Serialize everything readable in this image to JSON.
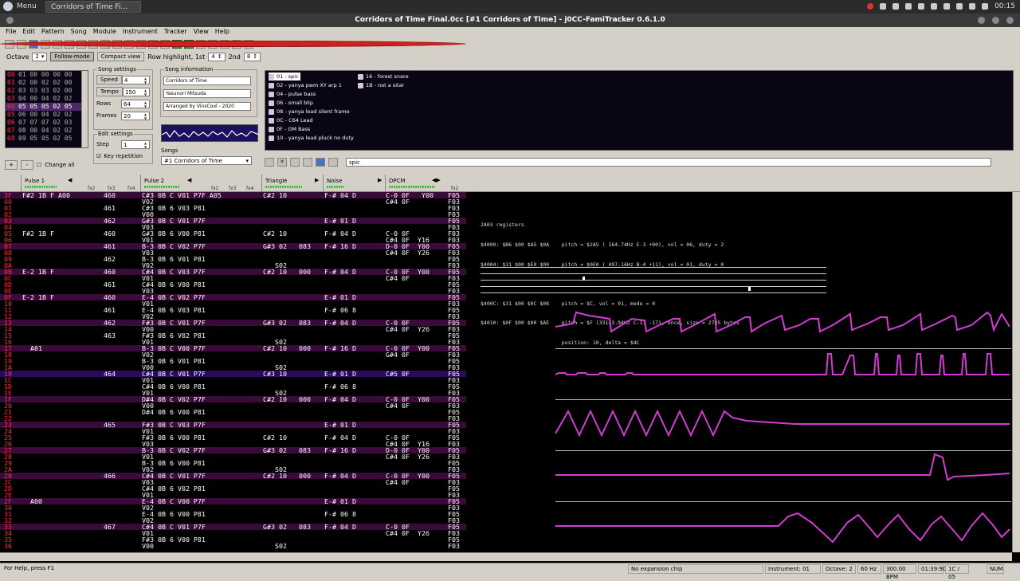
{
  "taskbar": {
    "menu_label": "Menu",
    "task_label": "Corridors of Time Fi...",
    "clock": "00:15"
  },
  "window": {
    "title": "Corridors of Time Final.0cc [#1 Corridors of Time] - j0CC-FamiTracker 0.6.1.0"
  },
  "menubar": [
    "File",
    "Edit",
    "Pattern",
    "Song",
    "Module",
    "Instrument",
    "Tracker",
    "View",
    "Help"
  ],
  "options": {
    "octave_label": "Octave",
    "octave_value": "2",
    "follow": "Follow-mode",
    "compact": "Compact view",
    "highlight_label": "Row highlight, 1st",
    "highlight1": "4",
    "second_label": "2nd",
    "highlight2": "8"
  },
  "frames": [
    {
      "n": "00",
      "v": "01 00 00 00 00"
    },
    {
      "n": "01",
      "v": "02 00 02 02 00"
    },
    {
      "n": "02",
      "v": "03 03 03 02 00"
    },
    {
      "n": "03",
      "v": "04 00 04 02 02"
    },
    {
      "n": "04",
      "v": "05 05 05 02 05"
    },
    {
      "n": "05",
      "v": "06 00 04 02 02"
    },
    {
      "n": "06",
      "v": "07 07 07 02 03"
    },
    {
      "n": "07",
      "v": "08 00 04 02 02"
    },
    {
      "n": "08",
      "v": "09 05 05 02 05"
    }
  ],
  "song_settings": {
    "title": "Song settings",
    "speed_label": "Speed",
    "speed": "4",
    "tempo_label": "Tempo",
    "tempo": "150",
    "rows_label": "Rows",
    "rows": "64",
    "frames_label": "Frames",
    "frames": "20"
  },
  "edit_settings": {
    "title": "Edit settings",
    "step_label": "Step",
    "step": "1",
    "keyrep": "Key repetition"
  },
  "song_info": {
    "title": "Song information",
    "name": "Corridors of Time",
    "artist": "Yasunori Mitsuda",
    "copyright": "Arranged by VinsCool - 2020"
  },
  "songs": {
    "title": "Songs",
    "selected": "#1 Corridors of Time"
  },
  "instruments": [
    "01 - spic",
    "02 - yanya pwm XY arp 1",
    "04 - pulse bass",
    "06 - small blip",
    "08 - yanya lead silent frame",
    "0C - C64 Lead",
    "0F - GM Bass",
    "10 - yanya lead pluck no duty",
    "16 - forest snare",
    "1B - not a sitar"
  ],
  "instrument_name": "spic",
  "frame_controls": {
    "change_all": "Change all"
  },
  "channels": [
    "Pulse 1",
    "Pulse 2",
    "Triangle",
    "Noise",
    "DPCM"
  ],
  "effect_cols": [
    "fx2",
    "fx3",
    "fx4"
  ],
  "rows": [
    {
      "n": "3F",
      "p1": "F#2 1B F A00",
      "p1b": "460",
      "p2": "C#3 0B C V01 P7F A05",
      "tri": "C#2 10",
      "noi": "F-# 04 D",
      "dp": "C-0 0F   Y00",
      "end": "F05"
    },
    {
      "n": "00",
      "p1": "",
      "p1b": "",
      "p2": "V02",
      "tri": "",
      "noi": "",
      "dp": "C#4 0F",
      "end": "F03"
    },
    {
      "n": "01",
      "p1": "",
      "p1b": "461",
      "p2": "C#3 0B 6 V03 P81",
      "tri": "",
      "noi": "",
      "dp": "",
      "end": "F03"
    },
    {
      "n": "02",
      "p1": "",
      "p1b": "",
      "p2": "V00",
      "tri": "",
      "noi": "",
      "dp": "",
      "end": "F03"
    },
    {
      "n": "03",
      "p1": "",
      "p1b": "462",
      "p2": "G#3 0B C V01 P7F",
      "tri": "",
      "noi": "E-# 01 D",
      "dp": "",
      "end": "F05"
    },
    {
      "n": "04",
      "p1": "",
      "p1b": "",
      "p2": "V03",
      "tri": "",
      "noi": "",
      "dp": "",
      "end": "F03"
    },
    {
      "n": "05",
      "p1": "F#2 1B F",
      "p1b": "460",
      "p2": "G#3 0B 6 V00 P81",
      "tri": "C#2 10",
      "noi": "F-# 04 D",
      "dp": "C-0 0F",
      "end": "F03"
    },
    {
      "n": "06",
      "p1": "",
      "p1b": "",
      "p2": "V01",
      "tri": "",
      "noi": "",
      "dp": "C#4 0F  Y16",
      "end": "F03"
    },
    {
      "n": "07",
      "p1": "",
      "p1b": "461",
      "p2": "B-3 0B C V02 P7F",
      "tri": "G#3 02   083",
      "noi": "F-# 16 D",
      "dp": "D-0 0F  Y00",
      "end": "F05"
    },
    {
      "n": "08",
      "p1": "",
      "p1b": "",
      "p2": "V03",
      "tri": "",
      "noi": "",
      "dp": "C#4 0F  Y26",
      "end": "F03"
    },
    {
      "n": "09",
      "p1": "",
      "p1b": "462",
      "p2": "B-3 0B 6 V01 P81",
      "tri": "",
      "noi": "",
      "dp": "",
      "end": "F05"
    },
    {
      "n": "0A",
      "p1": "",
      "p1b": "",
      "p2": "V02",
      "tri": "   S02",
      "noi": "",
      "dp": "",
      "end": "F03"
    },
    {
      "n": "0B",
      "p1": "E-2 1B F",
      "p1b": "460",
      "p2": "C#4 0B C V03 P7F",
      "tri": "C#2 10   000",
      "noi": "F-# 04 D",
      "dp": "C-0 0F  Y00",
      "end": "F05"
    },
    {
      "n": "0C",
      "p1": "",
      "p1b": "",
      "p2": "V01",
      "tri": "",
      "noi": "",
      "dp": "C#4 0F",
      "end": "F03"
    },
    {
      "n": "0D",
      "p1": "",
      "p1b": "461",
      "p2": "C#4 0B 6 V00 P81",
      "tri": "",
      "noi": "",
      "dp": "",
      "end": "F05"
    },
    {
      "n": "0E",
      "p1": "",
      "p1b": "",
      "p2": "V03",
      "tri": "",
      "noi": "",
      "dp": "",
      "end": "F03"
    },
    {
      "n": "0F",
      "p1": "E-2 1B F",
      "p1b": "460",
      "p2": "E-4 0B C V02 P7F",
      "tri": "",
      "noi": "E-# 01 D",
      "dp": "",
      "end": "F05"
    },
    {
      "n": "10",
      "p1": "",
      "p1b": "",
      "p2": "V01",
      "tri": "",
      "noi": "",
      "dp": "",
      "end": "F03"
    },
    {
      "n": "11",
      "p1": "",
      "p1b": "461",
      "p2": "E-4 0B 6 V03 P81",
      "tri": "",
      "noi": "F-# 06 8",
      "dp": "",
      "end": "F05"
    },
    {
      "n": "12",
      "p1": "",
      "p1b": "",
      "p2": "V02",
      "tri": "",
      "noi": "",
      "dp": "",
      "end": "F03"
    },
    {
      "n": "13",
      "p1": "",
      "p1b": "462",
      "p2": "F#3 0B C V01 P7F",
      "tri": "G#3 02   083",
      "noi": "F-# 04 D",
      "dp": "C-0 0F",
      "end": "F05"
    },
    {
      "n": "14",
      "p1": "",
      "p1b": "",
      "p2": "V00",
      "tri": "",
      "noi": "",
      "dp": "C#4 0F  Y26",
      "end": "F03"
    },
    {
      "n": "15",
      "p1": "",
      "p1b": "463",
      "p2": "F#3 0B 6 V02 P81",
      "tri": "",
      "noi": "",
      "dp": "",
      "end": "F05"
    },
    {
      "n": "16",
      "p1": "",
      "p1b": "",
      "p2": "V01",
      "tri": "   S02",
      "noi": "",
      "dp": "",
      "end": "F03"
    },
    {
      "n": "17",
      "p1": "  A01",
      "p1b": "",
      "p2": "B-3 0B C V00 P7F",
      "tri": "C#2 10   000",
      "noi": "F-# 16 D",
      "dp": "C-0 0F  Y00",
      "end": "F05"
    },
    {
      "n": "18",
      "p1": "",
      "p1b": "",
      "p2": "V02",
      "tri": "",
      "noi": "",
      "dp": "G#4 0F",
      "end": "F03"
    },
    {
      "n": "19",
      "p1": "",
      "p1b": "",
      "p2": "B-3 0B 6 V01 P81",
      "tri": "",
      "noi": "",
      "dp": "",
      "end": "F05"
    },
    {
      "n": "1A",
      "p1": "",
      "p1b": "",
      "p2": "V00",
      "tri": "   S02",
      "noi": "",
      "dp": "",
      "end": "F03"
    },
    {
      "n": "1B",
      "p1": "",
      "p1b": "464",
      "p2": "C#4 0B C V01 P7F",
      "tri": "C#3 10",
      "noi": "E-# 01 D",
      "dp": "C#5 0F",
      "end": "F05"
    },
    {
      "n": "1C",
      "p1": "",
      "p1b": "",
      "p2": "V01",
      "tri": "",
      "noi": "",
      "dp": "",
      "end": "F03"
    },
    {
      "n": "1D",
      "p1": "",
      "p1b": "",
      "p2": "C#4 0B 6 V00 P81",
      "tri": "",
      "noi": "F-# 06 8",
      "dp": "",
      "end": "F05"
    },
    {
      "n": "1E",
      "p1": "",
      "p1b": "",
      "p2": "V01",
      "tri": "   S02",
      "noi": "",
      "dp": "",
      "end": "F03"
    },
    {
      "n": "1F",
      "p1": "",
      "p1b": "",
      "p2": "D#4 0B C V02 P7F",
      "tri": "C#2 10   000",
      "noi": "F-# 04 D",
      "dp": "C-0 0F  Y00",
      "end": "F05"
    },
    {
      "n": "20",
      "p1": "",
      "p1b": "",
      "p2": "V00",
      "tri": "",
      "noi": "",
      "dp": "C#4 0F",
      "end": "F03"
    },
    {
      "n": "21",
      "p1": "",
      "p1b": "",
      "p2": "D#4 0B 6 V00 P81",
      "tri": "",
      "noi": "",
      "dp": "",
      "end": "F05"
    },
    {
      "n": "22",
      "p1": "",
      "p1b": "",
      "p2": "",
      "tri": "",
      "noi": "",
      "dp": "",
      "end": "F03"
    },
    {
      "n": "23",
      "p1": "",
      "p1b": "465",
      "p2": "F#3 0B C V03 P7F",
      "tri": "",
      "noi": "E-# 01 D",
      "dp": "",
      "end": "F05"
    },
    {
      "n": "24",
      "p1": "",
      "p1b": "",
      "p2": "V01",
      "tri": "",
      "noi": "",
      "dp": "",
      "end": "F03"
    },
    {
      "n": "25",
      "p1": "",
      "p1b": "",
      "p2": "F#3 0B 6 V00 P81",
      "tri": "C#2 10",
      "noi": "F-# 04 D",
      "dp": "C-0 0F",
      "end": "F05"
    },
    {
      "n": "26",
      "p1": "",
      "p1b": "",
      "p2": "V03",
      "tri": "",
      "noi": "",
      "dp": "C#4 0F  Y16",
      "end": "F03"
    },
    {
      "n": "27",
      "p1": "",
      "p1b": "",
      "p2": "B-3 0B C V02 P7F",
      "tri": "G#3 02   083",
      "noi": "F-# 16 D",
      "dp": "D-0 0F  Y00",
      "end": "F05"
    },
    {
      "n": "28",
      "p1": "",
      "p1b": "",
      "p2": "V01",
      "tri": "",
      "noi": "",
      "dp": "C#4 0F  Y26",
      "end": "F03"
    },
    {
      "n": "29",
      "p1": "",
      "p1b": "",
      "p2": "B-3 0B 6 V00 P81",
      "tri": "",
      "noi": "",
      "dp": "",
      "end": "F05"
    },
    {
      "n": "2A",
      "p1": "",
      "p1b": "",
      "p2": "V02",
      "tri": "   S02",
      "noi": "",
      "dp": "",
      "end": "F03"
    },
    {
      "n": "2B",
      "p1": "",
      "p1b": "466",
      "p2": "C#4 0B C V01 P7F",
      "tri": "C#2 10   000",
      "noi": "F-# 04 D",
      "dp": "C-0 0F  Y00",
      "end": "F05"
    },
    {
      "n": "2C",
      "p1": "",
      "p1b": "",
      "p2": "V03",
      "tri": "",
      "noi": "",
      "dp": "C#4 0F",
      "end": "F03"
    },
    {
      "n": "2D",
      "p1": "",
      "p1b": "",
      "p2": "C#4 0B 6 V02 P81",
      "tri": "",
      "noi": "",
      "dp": "",
      "end": "F05"
    },
    {
      "n": "2E",
      "p1": "",
      "p1b": "",
      "p2": "V01",
      "tri": "",
      "noi": "",
      "dp": "",
      "end": "F03"
    },
    {
      "n": "2F",
      "p1": "  A00",
      "p1b": "",
      "p2": "E-4 0B C V00 P7F",
      "tri": "",
      "noi": "E-# 01 D",
      "dp": "",
      "end": "F05"
    },
    {
      "n": "30",
      "p1": "",
      "p1b": "",
      "p2": "V02",
      "tri": "",
      "noi": "",
      "dp": "",
      "end": "F03"
    },
    {
      "n": "31",
      "p1": "",
      "p1b": "",
      "p2": "E-4 0B 6 V00 P81",
      "tri": "",
      "noi": "F-# 06 8",
      "dp": "",
      "end": "F05"
    },
    {
      "n": "32",
      "p1": "",
      "p1b": "",
      "p2": "V02",
      "tri": "",
      "noi": "",
      "dp": "",
      "end": "F03"
    },
    {
      "n": "33",
      "p1": "",
      "p1b": "467",
      "p2": "C#4 0B C V01 P7F",
      "tri": "G#3 02   083",
      "noi": "F-# 04 D",
      "dp": "C-0 0F",
      "end": "F05"
    },
    {
      "n": "34",
      "p1": "",
      "p1b": "",
      "p2": "V01",
      "tri": "",
      "noi": "",
      "dp": "C#4 0F  Y26",
      "end": "F03"
    },
    {
      "n": "35",
      "p1": "",
      "p1b": "",
      "p2": "F#3 0B 6 V00 P81",
      "tri": "",
      "noi": "",
      "dp": "",
      "end": "F05"
    },
    {
      "n": "36",
      "p1": "",
      "p1b": "",
      "p2": "V00",
      "tri": "   S02",
      "noi": "",
      "dp": "",
      "end": "F03"
    }
  ],
  "registers": [
    "2A03 registers",
    "$4000: $B6 $00 $A5 $0A    pitch = $2A5 ( 164.74Hz E-3 +00), vol = 06, duty = 2",
    "$4004: $31 $00 $E0 $00    pitch = $0E0 ( 497.16Hz B-4 +11), vol = 01, duty = 0",
    "$4008: $FF $00 $1A $0A    pitch = $21A ( 103.77Hz G#2 +00)",
    "$400C: $31 $00 $0C $08    pitch = $C, vol = 01, mode = 0",
    "$4010: $0F $00 $00 $AE    pitch = $F (33143.94Hz C-11 -17), once, size = 2785 bytes",
    "                          position: 10, delta = $4C"
  ],
  "status": {
    "help": "For Help, press F1",
    "chip": "No expansion chip",
    "instrument": "Instrument: 01",
    "octave": "Octave: 2",
    "rate": "60 Hz",
    "bpm": "300.00 BPM",
    "time": "01:39:90",
    "pos": "1C / 05",
    "num": "NUM"
  },
  "colors": {
    "row_num": "#ff3030",
    "wave": "#d23cd2",
    "highlight_row": "#3a0a3a",
    "cursor_row": "#2a0a5a"
  }
}
